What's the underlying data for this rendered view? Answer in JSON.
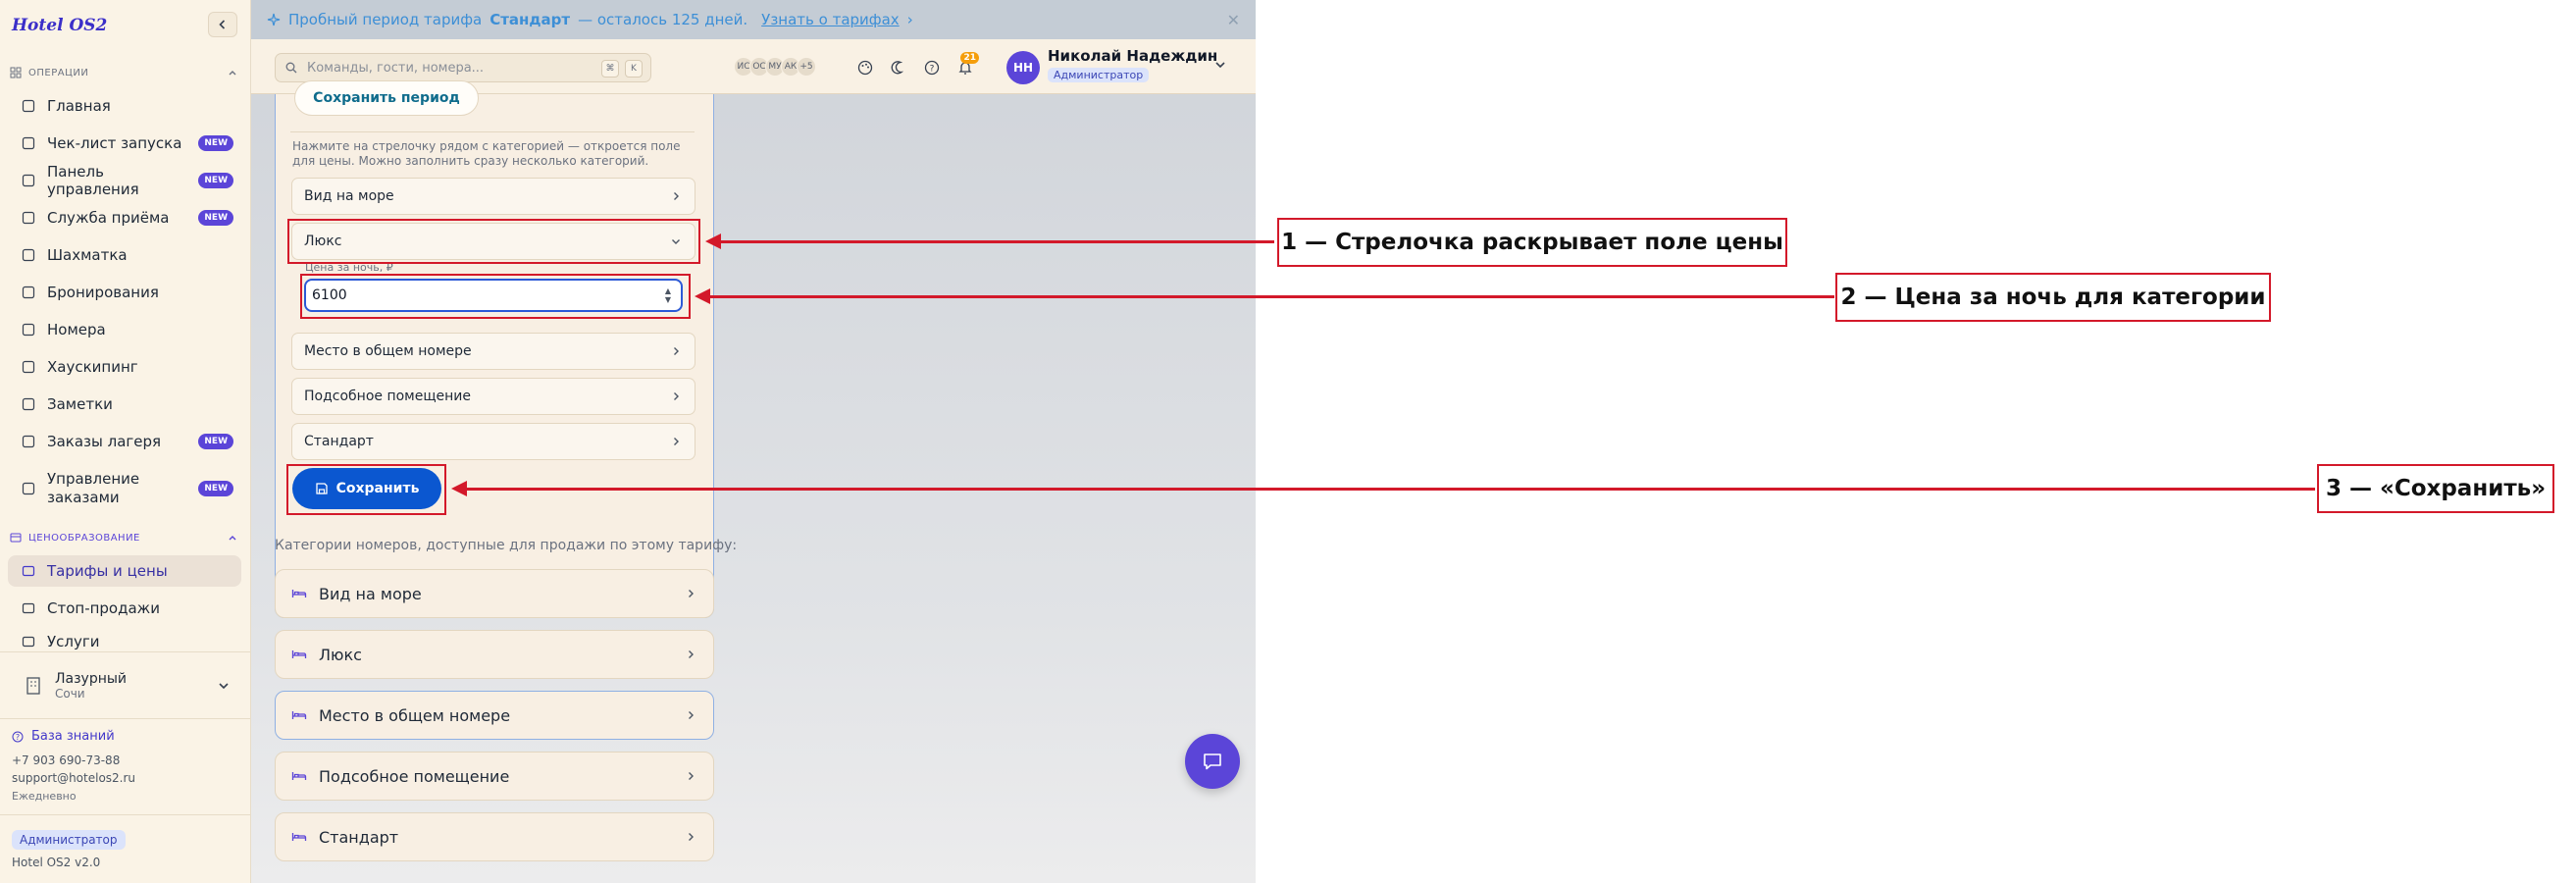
{
  "brand": "Hotel OS2",
  "sidebar": {
    "section_ops": "ОПЕРАЦИИ",
    "ops_items": [
      {
        "label": "Главная",
        "icon": "grid-icon",
        "badge": ""
      },
      {
        "label": "Чек-лист запуска",
        "icon": "rocket-icon",
        "badge": "NEW"
      },
      {
        "label": "Панель управления",
        "icon": "gauge-icon",
        "badge": "NEW"
      },
      {
        "label": "Служба приёма",
        "icon": "bell-desk-icon",
        "badge": "NEW"
      },
      {
        "label": "Шахматка",
        "icon": "table-icon",
        "badge": ""
      },
      {
        "label": "Бронирования",
        "icon": "clipboard-icon",
        "badge": ""
      },
      {
        "label": "Номера",
        "icon": "door-icon",
        "badge": ""
      },
      {
        "label": "Хаускипинг",
        "icon": "sparkle-icon",
        "badge": ""
      },
      {
        "label": "Заметки",
        "icon": "note-icon",
        "badge": ""
      },
      {
        "label": "Заказы лагеря",
        "icon": "tent-icon",
        "badge": "NEW"
      },
      {
        "label": "Управление заказами",
        "icon": "order-icon",
        "badge": "NEW"
      }
    ],
    "section_pricing": "ЦЕНООБРАЗОВАНИЕ",
    "pricing_items": [
      {
        "label": "Тарифы и цены",
        "icon": "card-icon"
      },
      {
        "label": "Стоп-продажи",
        "icon": "ban-icon"
      },
      {
        "label": "Услуги",
        "icon": "tag-icon"
      }
    ],
    "hotel_name": "Лазурный",
    "hotel_city": "Сочи",
    "kb_label": "База знаний",
    "phone": "+7 903 690-73-88",
    "email": "support@hotelos2.ru",
    "schedule": "Ежедневно",
    "role": "Администратор",
    "version": "Hotel OS2 v2.0"
  },
  "promo": {
    "text_prefix": "Пробный период тарифа",
    "plan": "Стандарт",
    "text_suffix": "— осталось 125 дней.",
    "link": "Узнать о тарифах"
  },
  "topbar": {
    "search_placeholder": "Команды, гости, номера...",
    "kbd1": "⌘",
    "kbd2": "K",
    "avatars": [
      "ИС",
      "ОС",
      "МУ",
      "АК",
      "+5"
    ],
    "notif_count": "21",
    "user_initials": "НН",
    "user_name": "Николай Надеждин",
    "user_role": "Администратор"
  },
  "tariff": {
    "save_period": "Сохранить период",
    "hint": "Нажмите на стрелочку рядом с категорией — откроется поле для цены. Можно заполнить сразу несколько категорий.",
    "rows": [
      "Вид на море",
      "Люкс",
      "Место в общем номере",
      "Подсобное помещение",
      "Стандарт"
    ],
    "price_label": "Цена за ночь, ₽",
    "price_value": "6100",
    "save_button": "Сохранить"
  },
  "categories": {
    "title": "Категории номеров, доступные для продажи по этому тарифу:",
    "items": [
      "Вид на море",
      "Люкс",
      "Место в общем номере",
      "Подсобное помещение",
      "Стандарт"
    ]
  },
  "callouts": [
    "1 — Стрелочка раскрывает поле цены",
    "2 — Цена за ночь для категории",
    "3 — «Сохранить»"
  ],
  "colors": {
    "accent": "#5b45d8",
    "primary_button": "#0b57d0",
    "annotation": "#d3192a"
  }
}
